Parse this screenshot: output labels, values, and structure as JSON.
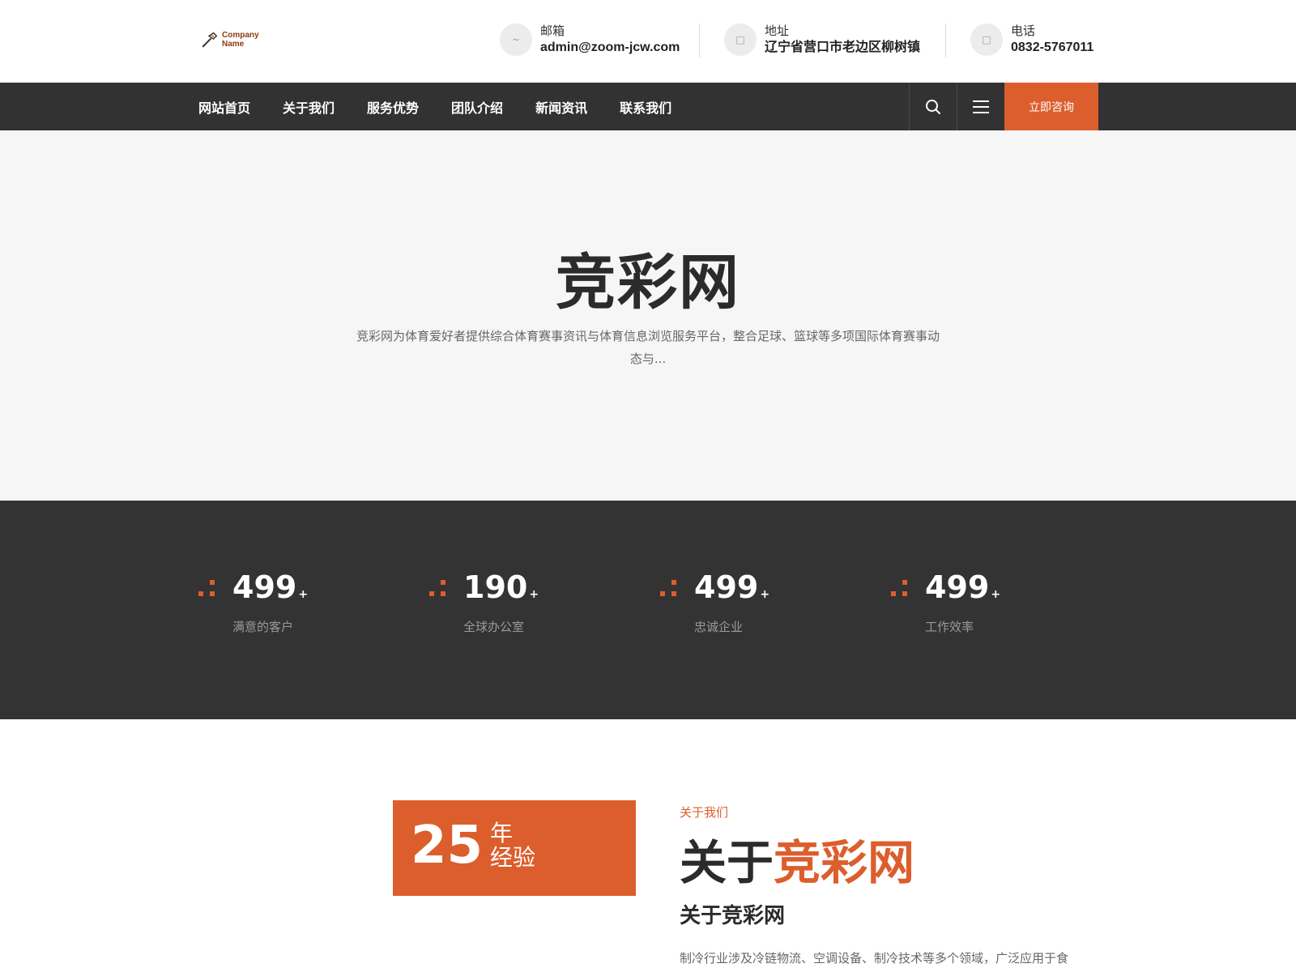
{
  "header": {
    "logo_text": "Company\nName",
    "email": {
      "label": "邮箱",
      "value": "admin@zoom-jcw.com",
      "icon": "email-icon"
    },
    "address": {
      "label": "地址",
      "value": "辽宁省营口市老边区柳树镇",
      "icon": "location-icon"
    },
    "phone": {
      "label": "电话",
      "value": "0832-5767011",
      "icon": "phone-icon"
    }
  },
  "nav": {
    "items": [
      "网站首页",
      "关于我们",
      "服务优势",
      "团队介绍",
      "新闻资讯",
      "联系我们"
    ],
    "consult_label": "立即咨询"
  },
  "hero": {
    "title": "竞彩网",
    "description": "竞彩网为体育爱好者提供综合体育赛事资讯与体育信息浏览服务平台，整合足球、篮球等多项国际体育赛事动态与..."
  },
  "stats": [
    {
      "value": "499",
      "suffix": "+",
      "label": "满意的客户"
    },
    {
      "value": "190",
      "suffix": "+",
      "label": "全球办公室"
    },
    {
      "value": "499",
      "suffix": "+",
      "label": "忠诚企业"
    },
    {
      "value": "499",
      "suffix": "+",
      "label": "工作效率"
    }
  ],
  "about": {
    "years": "25",
    "years_unit": "年",
    "years_label": "经验",
    "subtitle": "关于我们",
    "title_prefix": "关于",
    "title_accent": "竞彩网",
    "heading": "关于竞彩网",
    "text": "制冷行业涉及冷链物流、空调设备、制冷技术等多个领域，广泛应用于食"
  },
  "colors": {
    "accent": "#dc5e2c",
    "dark": "#333333",
    "hero_bg": "#f6f6f6"
  }
}
